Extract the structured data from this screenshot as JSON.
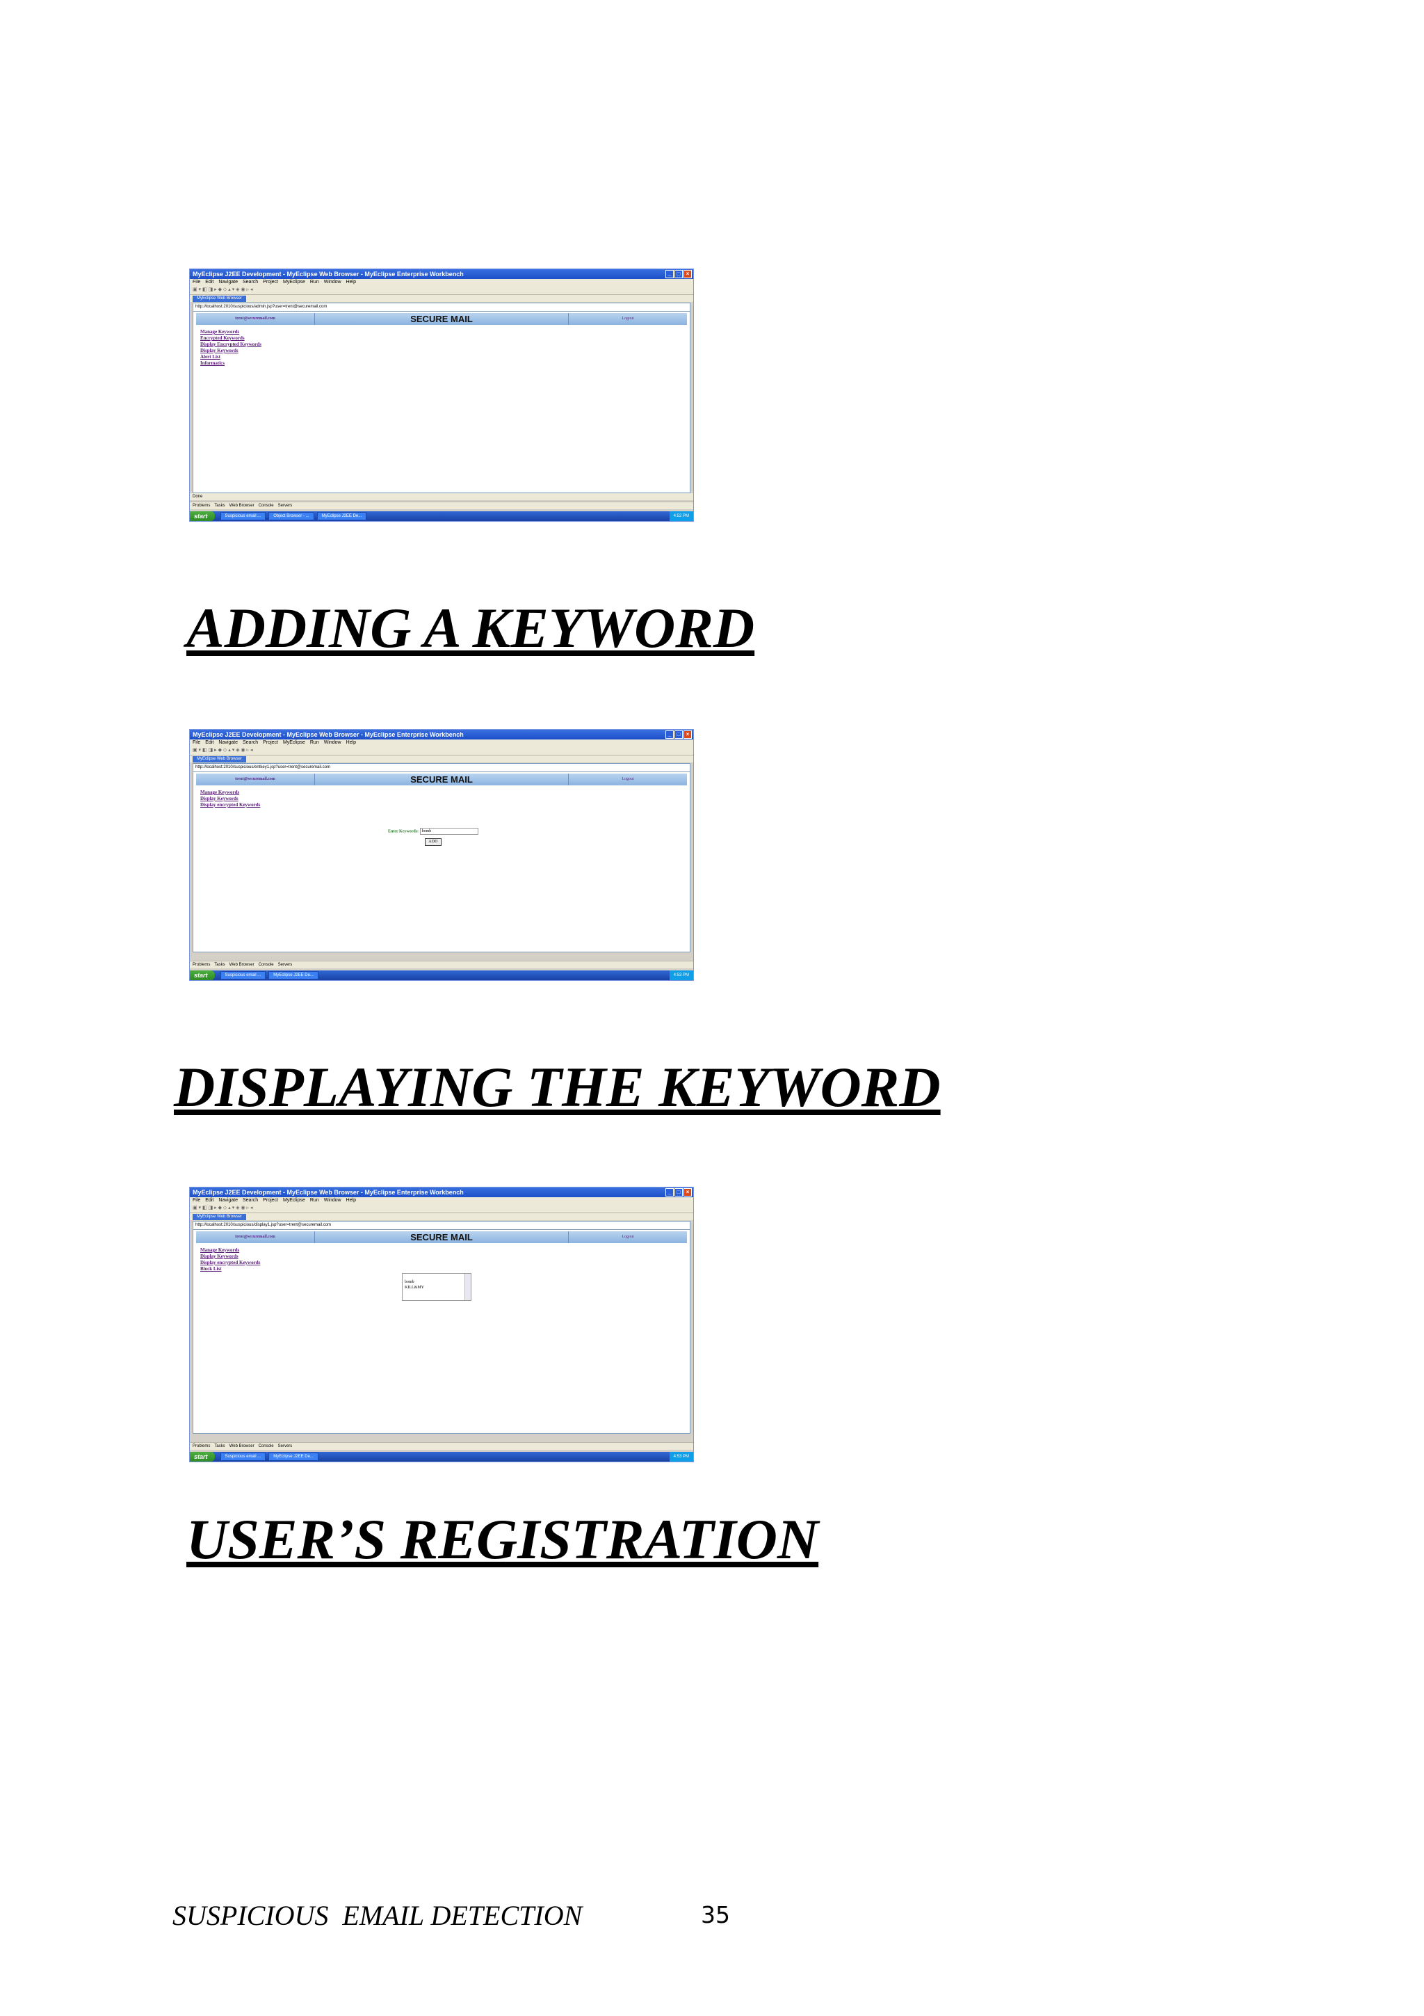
{
  "screenshots": [
    {
      "window_title": "MyEclipse J2EE Development - MyEclipse Web Browser - MyEclipse Enterprise Workbench",
      "menu": [
        "File",
        "Edit",
        "Navigate",
        "Search",
        "Project",
        "MyEclipse",
        "Run",
        "Window",
        "Help"
      ],
      "tab_label": "MyEclipse Web Browser",
      "url": "http://localhost:2010/suspicious/admin.jsp?user=trent@securemail.com",
      "site": {
        "user": "trent@securemail.com",
        "title": "SECURE MAIL",
        "logout": "Logout"
      },
      "links": [
        "Manage Keywords",
        "Encrypted Keywords",
        "Display Encrypted Keywords",
        "Display Keywords",
        "Alert List",
        "Informatics"
      ],
      "status": "Done",
      "view_tabs": [
        "Problems",
        "Tasks",
        "Web Browser",
        "Console",
        "Servers"
      ],
      "taskbar": {
        "start": "start",
        "tasks": [
          "Suspicious email ...",
          "Object Browser - ...",
          "MyEclipse J2EE De..."
        ],
        "clock": "4:52 PM"
      }
    },
    {
      "window_title": "MyEclipse J2EE Development - MyEclipse Web Browser - MyEclipse Enterprise Workbench",
      "menu": [
        "File",
        "Edit",
        "Navigate",
        "Search",
        "Project",
        "MyEclipse",
        "Run",
        "Window",
        "Help"
      ],
      "tab_label": "MyEclipse Web Browser",
      "url": "http://localhost:2010/suspicious/entkey1.jsp?user=trent@securemail.com",
      "site": {
        "user": "trent@securemail.com",
        "title": "SECURE MAIL",
        "logout": "Logout"
      },
      "links": [
        "Manage Keywords",
        "Display Keywords",
        "Display encrypted Keywords"
      ],
      "form": {
        "label": "Enter Keywords:",
        "value": "bomb",
        "button": "ADD"
      },
      "view_tabs": [
        "Problems",
        "Tasks",
        "Web Browser",
        "Console",
        "Servers"
      ],
      "taskbar": {
        "start": "start",
        "tasks": [
          "Suspicious email ...",
          "MyEclipse J2EE De..."
        ],
        "clock": "4:53 PM"
      }
    },
    {
      "window_title": "MyEclipse J2EE Development - MyEclipse Web Browser - MyEclipse Enterprise Workbench",
      "menu": [
        "File",
        "Edit",
        "Navigate",
        "Search",
        "Project",
        "MyEclipse",
        "Run",
        "Window",
        "Help"
      ],
      "tab_label": "MyEclipse Web Browser",
      "url": "http://localhost:2010/suspicious/display1.jsp?user=trent@securemail.com",
      "site": {
        "user": "trent@securemail.com",
        "title": "SECURE MAIL",
        "logout": "Logout"
      },
      "links": [
        "Manage Keywords",
        "Display Keywords",
        "Display encrypted Keywords",
        "Block List"
      ],
      "list_items": [
        "bomb",
        "KILL&MY"
      ],
      "view_tabs": [
        "Problems",
        "Tasks",
        "Web Browser",
        "Console",
        "Servers"
      ],
      "taskbar": {
        "start": "start",
        "tasks": [
          "Suspicious email ...",
          "MyEclipse J2EE De..."
        ],
        "clock": "4:53 PM"
      }
    }
  ],
  "headings": [
    "ADDING A KEYWORD",
    "DISPLAYING THE KEYWORD",
    "USER’S REGISTRATION"
  ],
  "footer": {
    "title": "SUSPICIOUS  EMAIL DETECTION",
    "page": "35"
  }
}
